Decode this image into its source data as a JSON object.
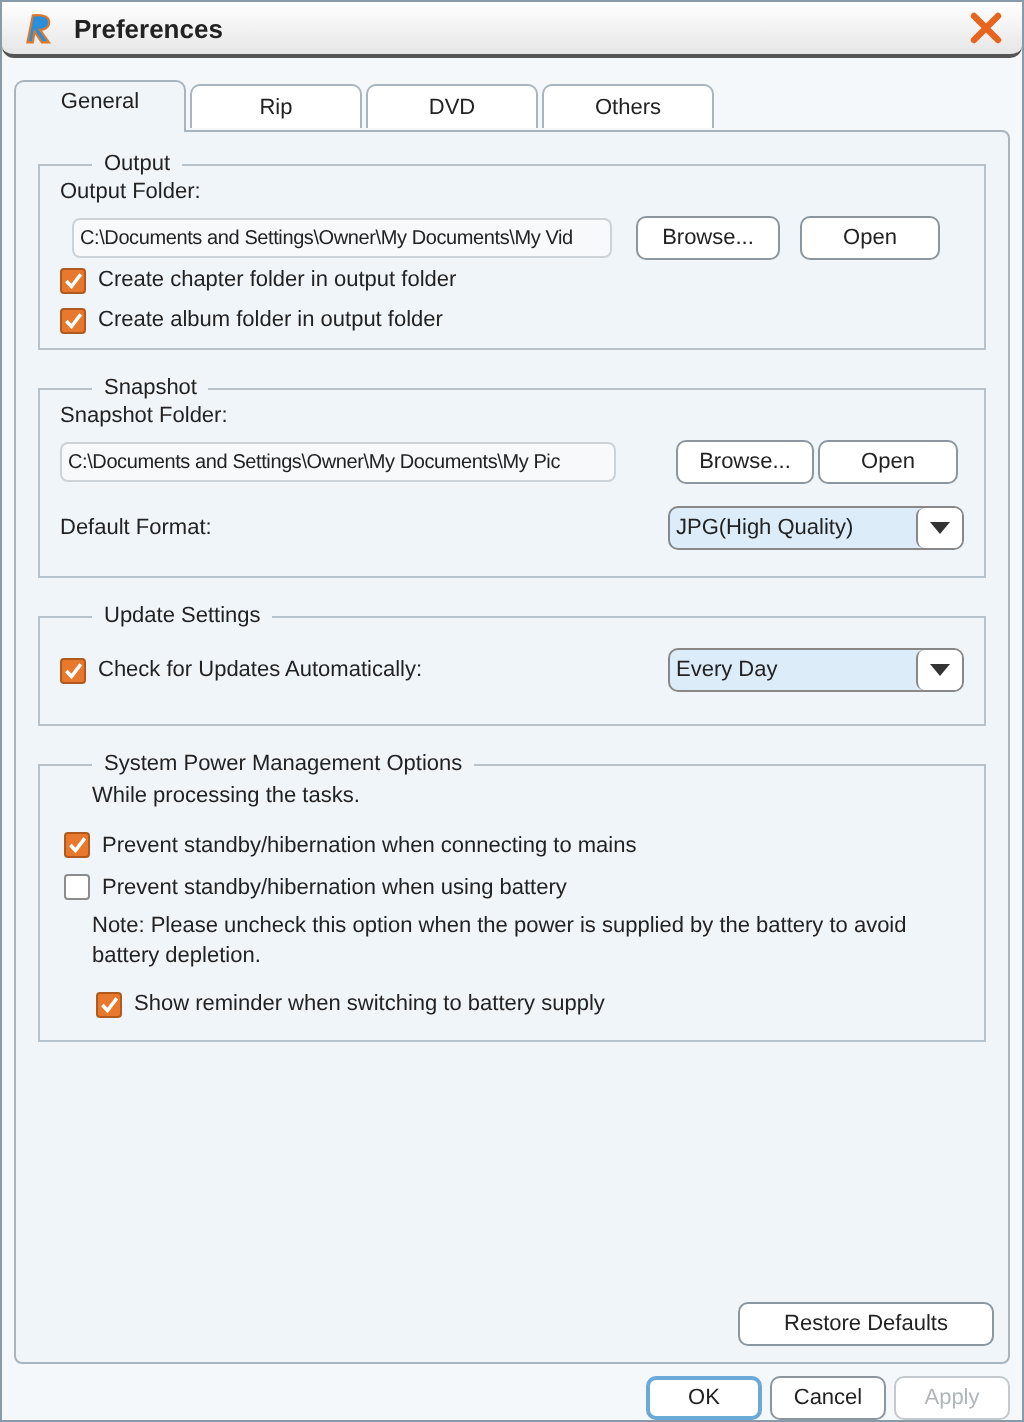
{
  "window": {
    "title": "Preferences"
  },
  "tabs": [
    {
      "label": "General",
      "selected": true
    },
    {
      "label": "Rip",
      "selected": false
    },
    {
      "label": "DVD",
      "selected": false
    },
    {
      "label": "Others",
      "selected": false
    }
  ],
  "output": {
    "title": "Output",
    "folder_label": "Output Folder:",
    "folder_value": "C:\\Documents and Settings\\Owner\\My Documents\\My Vid",
    "buttons": [
      "Browse...",
      "Open"
    ],
    "checkboxes": [
      {
        "label": "Create chapter folder in output folder",
        "checked": true
      },
      {
        "label": "Create album folder in output folder",
        "checked": true
      }
    ]
  },
  "snapshot": {
    "title": "Snapshot",
    "folder_label": "Snapshot Folder:",
    "folder_value": "C:\\Documents and Settings\\Owner\\My Documents\\My Pic",
    "buttons": [
      "Browse...",
      "Open"
    ],
    "format_label": "Default Format:",
    "format_value": "JPG(High Quality)"
  },
  "update": {
    "title": "Update Settings",
    "checkbox": {
      "label": "Check for Updates Automatically:",
      "checked": true
    },
    "value": "Every Day"
  },
  "power": {
    "title": "System Power Management Options",
    "intro": "While processing the tasks.",
    "options": [
      {
        "label": "Prevent standby/hibernation when connecting to mains",
        "checked": true
      },
      {
        "label": "Prevent standby/hibernation when using battery",
        "checked": false
      }
    ],
    "note": "Note: Please uncheck this option when the power is supplied by the battery to avoid battery depletion.",
    "reminder": {
      "label": "Show reminder when switching to battery supply",
      "checked": true
    }
  },
  "restore_button": "Restore Defaults",
  "buttons": [
    {
      "label": "OK",
      "default": true,
      "disabled": false
    },
    {
      "label": "Cancel",
      "default": false,
      "disabled": false
    },
    {
      "label": "Apply",
      "default": false,
      "disabled": true
    }
  ]
}
